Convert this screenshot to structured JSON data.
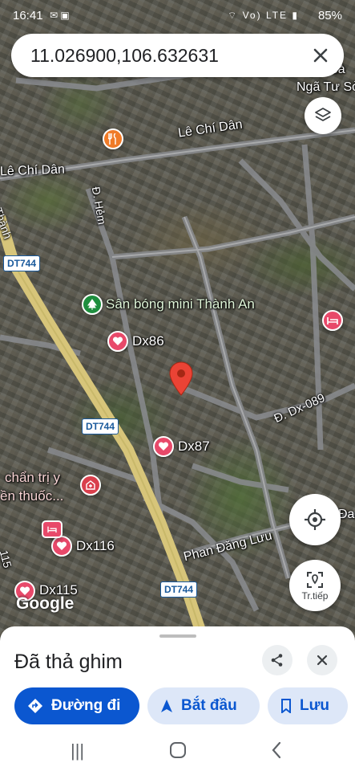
{
  "status_bar": {
    "time": "16:41",
    "network": "Vo) LTE",
    "battery": "85%"
  },
  "search": {
    "query": "11.026900,106.632631"
  },
  "map": {
    "road_labels": {
      "le_chi_dan_right": "Lê Chí Dân",
      "le_chi_dan_left": "Lê Chí Dân",
      "hem": "Đ. Hẻm",
      "dx089": "Đ. Dx-089",
      "phan_dang_luu": "Phan Đăng Lưu",
      "nga_tu_so": "Ngã Tư Sở",
      "thanh": "Thành",
      "hoa": "h Hoà",
      "da": "Đa"
    },
    "route_shields": [
      "DT744",
      "DT744",
      "DT744"
    ],
    "places": {
      "san_bong": "Sân bóng mini Thành An",
      "dx86": "Dx86",
      "dx87": "Dx87",
      "dx116": "Dx116",
      "dx115": "Dx115",
      "chan_tri": "chẩn trị y",
      "en_thuoc": "ền thuốc...",
      "one_one_five": "115"
    },
    "google_logo": "Google",
    "streetview_label": "Tr.tiếp"
  },
  "sheet": {
    "title": "Đã thả ghim",
    "directions_label": "Đường đi",
    "start_label": "Bắt đầu",
    "save_label": "Lưu"
  },
  "colors": {
    "primary": "#0b57d0",
    "secondary_chip": "#dde7f8",
    "pin": "#ea4335",
    "heart": "#e8496a"
  }
}
